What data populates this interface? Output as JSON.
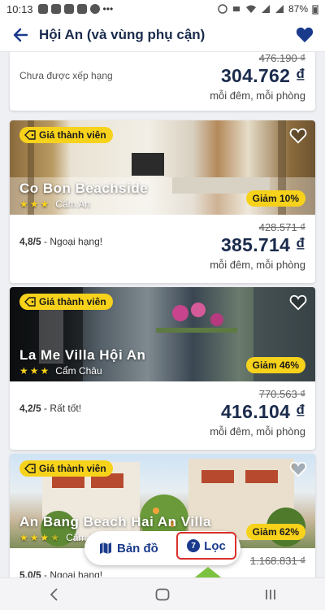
{
  "status_bar": {
    "time": "10:13",
    "battery": "87%"
  },
  "header": {
    "title": "Hội An (và vùng phụ cận)"
  },
  "listings": [
    {
      "rating": "Chưa được xếp hạng",
      "old_price": "476.190 ₫",
      "price": "304.762 ₫",
      "per": "mỗi đêm, mỗi phòng"
    },
    {
      "member_badge": "Giá thành viên",
      "name": "Co Bon Beachside",
      "stars": 3,
      "location": "Cẩm An",
      "discount": "Giảm 10%",
      "rating_score": "4,8/5",
      "rating_label": " - Ngoại hạng!",
      "old_price": "428.571 ₫",
      "price": "385.714 ₫",
      "per": "mỗi đêm, mỗi phòng"
    },
    {
      "member_badge": "Giá thành viên",
      "name": "La Me Villa Hội An",
      "stars": 3,
      "location": "Cẩm Châu",
      "discount": "Giảm 46%",
      "rating_score": "4,2/5",
      "rating_label": " - Rất tốt!",
      "old_price": "770.563 ₫",
      "price": "416.104 ₫",
      "per": "mỗi đêm, mỗi phòng"
    },
    {
      "member_badge": "Giá thành viên",
      "name": "An Bang Beach Hai An Villa",
      "stars": 3.5,
      "location": "Cẩm An",
      "discount": "Giảm 62%",
      "rating_score": "5,0/5",
      "rating_label": " - Ngoại hạng!",
      "old_price": "1.168.831 ₫"
    }
  ],
  "float_bar": {
    "map_label": "Bản đồ",
    "filter_label": "Lọc",
    "filter_count": "7"
  },
  "colors": {
    "brand": "#1a3a8c",
    "badge": "#f7d21b",
    "highlight": "#d9302b",
    "arrow": "#7cc242"
  }
}
